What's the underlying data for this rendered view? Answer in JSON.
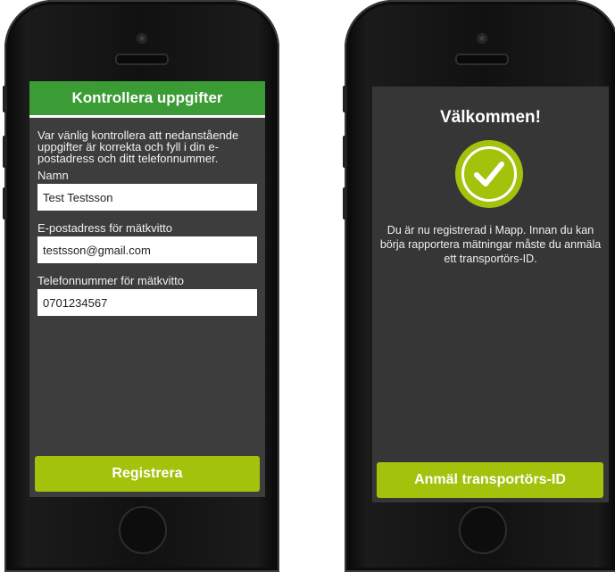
{
  "left_screen": {
    "title": "Kontrollera uppgifter",
    "intro": "Var vänlig kontrollera att nedanstående uppgifter är korrekta och fyll i din e-postadress och ditt telefonnummer.",
    "fields": [
      {
        "label": "Namn",
        "value": "Test Testsson"
      },
      {
        "label": "E-postadress för mätkvitto",
        "value": "testsson@gmail.com"
      },
      {
        "label": "Telefonnummer för mätkvitto",
        "value": "0701234567"
      }
    ],
    "submit_label": "Registrera"
  },
  "right_screen": {
    "title": "Välkommen!",
    "icon": "check-circle-icon",
    "message": "Du är nu registrerad i Mapp. Innan du kan börja rapportera mätningar måste du anmäla ett transportörs-ID.",
    "button_label": "Anmäl transportörs-ID"
  },
  "colors": {
    "header_green": "#3b9b35",
    "button_lime": "#a3c20b",
    "screen_dark": "#3d3d3d"
  }
}
